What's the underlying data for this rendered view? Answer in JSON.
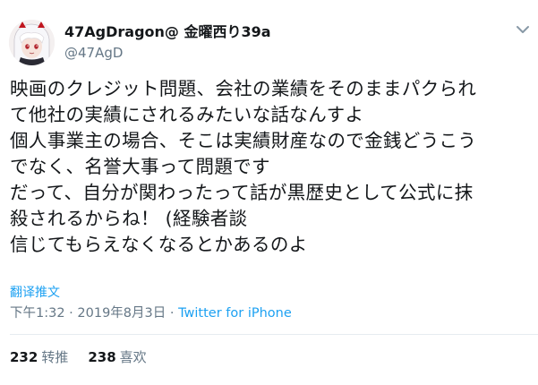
{
  "user": {
    "display_name": "47AgDragon@ 金曜西り39a",
    "handle": "@47AgD",
    "avatar_icon": "anime-character-avatar-icon"
  },
  "menu_icon": "chevron-down-icon",
  "tweet": {
    "lines": [
      "映画のクレジット問題、会社の業績をそのままパクられ",
      "て他社の実績にされるみたいな話なんすよ",
      "個人事業主の場合、そこは実績財産なので金銭どうこう",
      "でなく、名誉大事って問題です",
      "だって、自分が関わったって話が黒歴史として公式に抹",
      "殺されるからね！ (経験者談",
      "信じてもらえなくなるとかあるのよ"
    ],
    "translate_label": "翻译推文"
  },
  "meta": {
    "time": "下午1:32",
    "separator": " · ",
    "date": "2019年8月3日",
    "source": "Twitter for iPhone"
  },
  "stats": {
    "retweets_count": "232",
    "retweets_label": "转推",
    "likes_count": "238",
    "likes_label": "喜欢"
  },
  "colors": {
    "text": "#14171a",
    "secondary": "#657786",
    "link": "#1da1f2",
    "divider": "#e6ecf0"
  }
}
